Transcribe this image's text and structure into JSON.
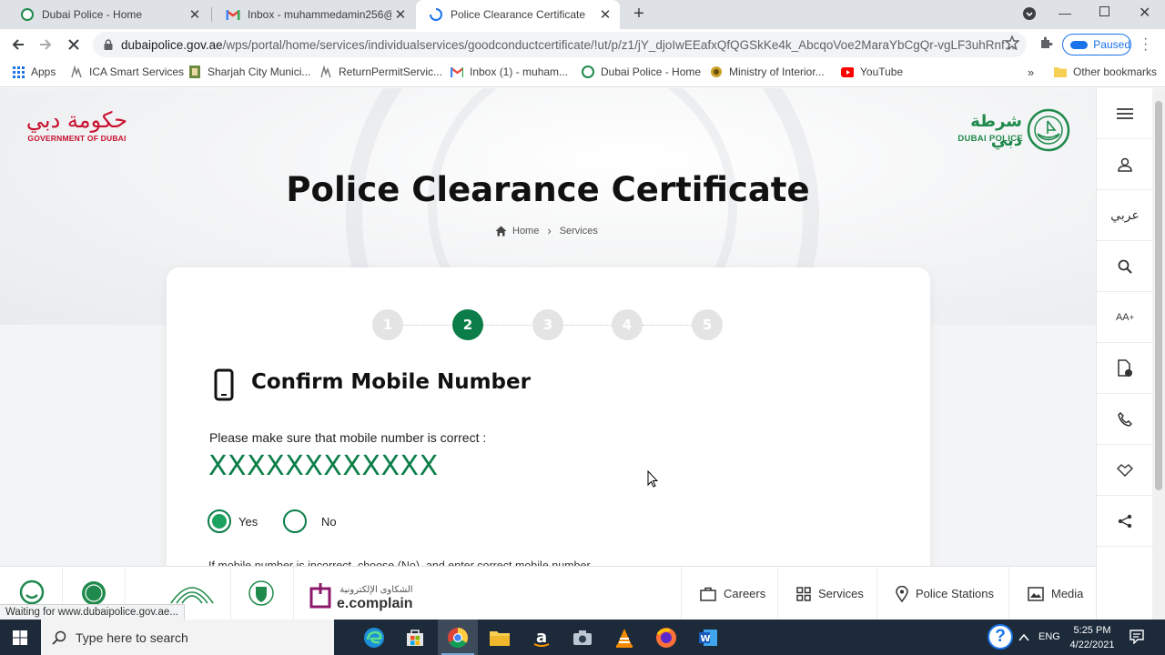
{
  "browser": {
    "tabs": [
      {
        "title": "Dubai Police - Home",
        "favicon": "dubai-police-favicon"
      },
      {
        "title": "Inbox - muhammedamin256@gm",
        "favicon": "gmail-icon"
      },
      {
        "title": "Police Clearance Certificate",
        "favicon": "loading-spinner-icon"
      }
    ],
    "new_tab": "+",
    "url_host": "dubaipolice.gov.ae",
    "url_path": "/wps/portal/home/services/individualservices/goodconductcertificate/!ut/p/z1/jY_djoIwEEafxQfQGSkKe4k_AbcqoVoe2MaraYbCgQr-vgLF3uhRnf...",
    "profile_status": "Paused",
    "bookmarks": [
      {
        "label": "Apps",
        "icon": "apps-grid-icon"
      },
      {
        "label": "ICA Smart Services",
        "icon": "ica-icon"
      },
      {
        "label": "Sharjah City Munici...",
        "icon": "sharjah-icon"
      },
      {
        "label": "ReturnPermitServic...",
        "icon": "ica-icon"
      },
      {
        "label": "Inbox (1) - muham...",
        "icon": "gmail-icon"
      },
      {
        "label": "Dubai Police - Home",
        "icon": "dubai-police-favicon"
      },
      {
        "label": "Ministry of Interior...",
        "icon": "moi-icon"
      },
      {
        "label": "YouTube",
        "icon": "youtube-icon"
      }
    ],
    "bookmarks_overflow": "»",
    "other_bookmarks": "Other bookmarks",
    "status_text": "Waiting for www.dubaipolice.gov.ae..."
  },
  "page": {
    "gov_logo_arabic": "حكومة دبي",
    "gov_logo_text": "GOVERNMENT OF DUBAI",
    "police_logo_arabic": "شرطة دبي",
    "police_logo_text": "DUBAI POLICE",
    "title": "Police Clearance Certificate",
    "breadcrumb": {
      "home": "Home",
      "separator": "›",
      "current": "Services"
    },
    "steps": [
      "1",
      "2",
      "3",
      "4",
      "5"
    ],
    "active_step": 2,
    "section_title": "Confirm Mobile Number",
    "prompt": "Please make sure that mobile number is correct :",
    "mobile_number": "XXXXXXXXXXXX",
    "options": {
      "yes": "Yes",
      "no": "No",
      "selected": "yes"
    },
    "hint": "If mobile number is incorrect, choose (No), and enter correct mobile number",
    "accent_color": "#0a7d48"
  },
  "right_bar": {
    "items": [
      {
        "icon": "menu-icon"
      },
      {
        "icon": "user-icon"
      },
      {
        "label": "عربي",
        "icon": "language-toggle"
      },
      {
        "icon": "search-icon"
      },
      {
        "label": "AA",
        "sup": "+",
        "icon": "font-size-icon"
      },
      {
        "icon": "document-info-icon"
      },
      {
        "icon": "phone-icon"
      },
      {
        "icon": "handshake-icon"
      },
      {
        "icon": "share-icon"
      }
    ]
  },
  "footer": {
    "ecomplain_arabic": "الشكاوى الإلكترونية",
    "ecomplain": "e.complain",
    "links": [
      {
        "label": "Careers",
        "icon": "briefcase-icon"
      },
      {
        "label": "Services",
        "icon": "grid-icon"
      },
      {
        "label": "Police Stations",
        "icon": "location-pin-icon"
      },
      {
        "label": "Media",
        "icon": "media-icon"
      }
    ]
  },
  "taskbar": {
    "search_placeholder": "Type here to search",
    "apps": [
      "edge-icon",
      "store-icon",
      "chrome-icon",
      "file-explorer-icon",
      "amazon-icon",
      "camera-icon",
      "vlc-icon",
      "firefox-icon",
      "word-icon"
    ],
    "language": "ENG",
    "time": "5:25 PM",
    "date": "4/22/2021",
    "help": "?"
  }
}
